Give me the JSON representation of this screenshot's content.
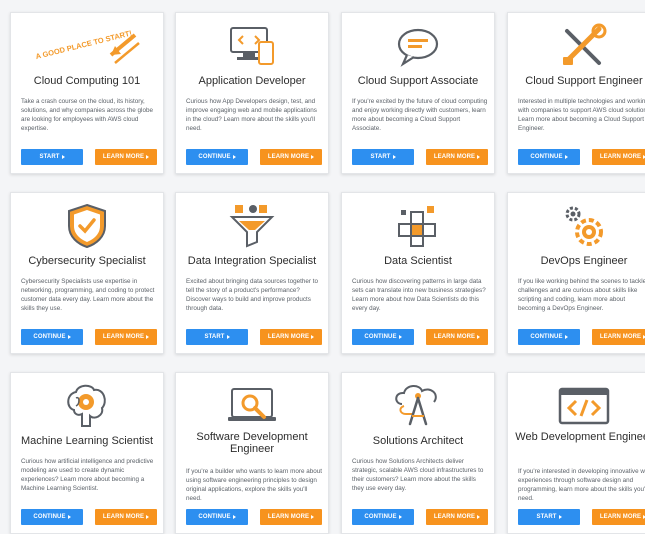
{
  "colors": {
    "primary_button": "#2d8ff0",
    "learn_more_button": "#f7931e",
    "icon_orange": "#f39a2b",
    "icon_gray": "#5a5f66"
  },
  "cards": [
    {
      "title": "Cloud Computing 101",
      "icon": "good-place-to-start-sign-icon",
      "icon_text": "A GOOD PLACE TO START!",
      "description": "Take a crash course on the cloud, its history, solutions, and why companies across the globe are looking for employees with AWS cloud expertise.",
      "primary_label": "START",
      "more_label": "LEARN MORE"
    },
    {
      "title": "Application Developer",
      "icon": "devices-icon",
      "description": "Curious how App Developers design, test, and improve engaging web and mobile applications in the cloud? Learn more about the skills you'll need.",
      "primary_label": "CONTINUE",
      "more_label": "LEARN MORE"
    },
    {
      "title": "Cloud Support Associate",
      "icon": "chat-bubble-icon",
      "description": "If you're excited by the future of cloud computing and enjoy working directly with customers, learn more about becoming a Cloud Support Associate.",
      "primary_label": "START",
      "more_label": "LEARN MORE"
    },
    {
      "title": "Cloud Support Engineer",
      "icon": "tools-icon",
      "description": "Interested in multiple technologies and working with companies to support AWS cloud solutions? Learn more about becoming a Cloud Support Engineer.",
      "primary_label": "CONTINUE",
      "more_label": "LEARN MORE"
    },
    {
      "title": "Cybersecurity Specialist",
      "icon": "shield-check-icon",
      "description": "Cybersecurity Specialists use expertise in networking, programming, and coding to protect customer data every day. Learn more about the skills they use.",
      "primary_label": "CONTINUE",
      "more_label": "LEARN MORE"
    },
    {
      "title": "Data Integration Specialist",
      "icon": "funnel-icon",
      "description": "Excited about bringing data sources together to tell the story of a product's performance? Discover ways to build and improve products through data.",
      "primary_label": "START",
      "more_label": "LEARN MORE"
    },
    {
      "title": "Data Scientist",
      "icon": "cubes-icon",
      "description": "Curious how discovering patterns in large data sets can translate into new business strategies? Learn more about how Data Scientists do this every day.",
      "primary_label": "CONTINUE",
      "more_label": "LEARN MORE"
    },
    {
      "title": "DevOps Engineer",
      "icon": "gears-icon",
      "description": "If you like working behind the scenes to tackle challenges and are curious about skills like scripting and coding, learn more about becoming a DevOps Engineer.",
      "primary_label": "CONTINUE",
      "more_label": "LEARN MORE"
    },
    {
      "title": "Machine Learning Scientist",
      "icon": "brain-gear-icon",
      "description": "Curious how artificial intelligence and predictive modeling are used to create dynamic experiences? Learn more about becoming a Machine Learning Scientist.",
      "primary_label": "CONTINUE",
      "more_label": "LEARN MORE"
    },
    {
      "title": "Software Development Engineer",
      "icon": "laptop-wrench-icon",
      "description": "If you're a builder who wants to learn more about using software engineering principles to design original applications, explore the skills you'll need.",
      "primary_label": "CONTINUE",
      "more_label": "LEARN MORE"
    },
    {
      "title": "Solutions Architect",
      "icon": "cloud-compass-icon",
      "description": "Curious how Solutions Architects deliver strategic, scalable AWS cloud infrastructures to their customers? Learn more about the skills they use every day.",
      "primary_label": "CONTINUE",
      "more_label": "LEARN MORE"
    },
    {
      "title": "Web Development Engineer",
      "icon": "code-window-icon",
      "description": "If you're interested in developing innovative web experiences through software design and programming, learn more about the skills you'll need.",
      "primary_label": "START",
      "more_label": "LEARN MORE"
    }
  ]
}
